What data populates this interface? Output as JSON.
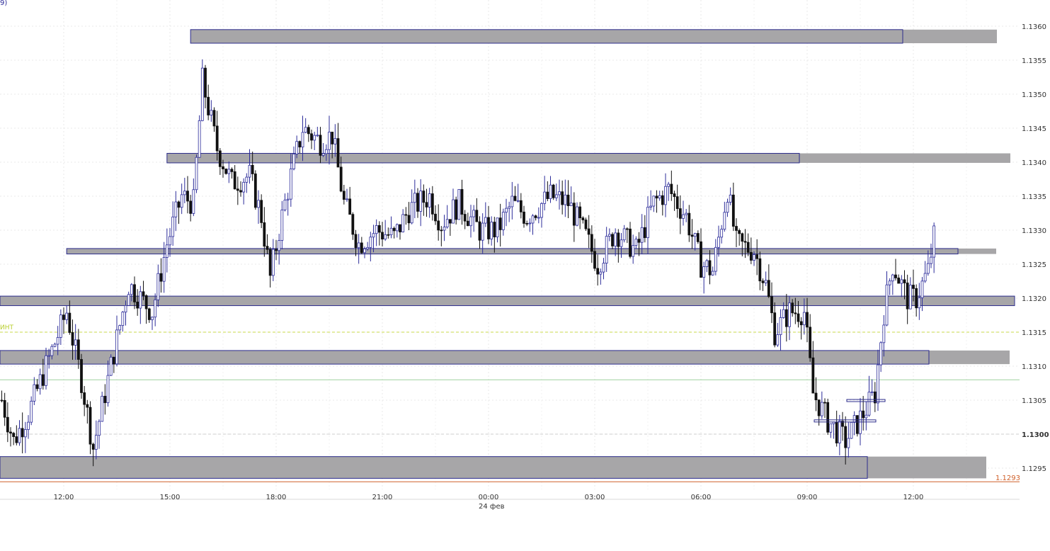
{
  "chart_data": {
    "type": "candlestick",
    "symbol_partial": "9)",
    "y_axis": {
      "ticks": [
        "1.1360",
        "1.1355",
        "1.1350",
        "1.1345",
        "1.1340",
        "1.1335",
        "1.1330",
        "1.1325",
        "1.1320",
        "1.1315",
        "1.1310",
        "1.1305",
        "1.1300",
        "1.1295"
      ],
      "ylim": [
        1.12925,
        1.13625
      ],
      "position": "right",
      "bold_tick": "1.1300"
    },
    "x_axis": {
      "ticks": [
        "12:00",
        "15:00",
        "18:00",
        "21:00",
        "00:00",
        "03:00",
        "06:00",
        "09:00",
        "12:00"
      ],
      "date_label": "24 фев",
      "date_under_tick": "00:00"
    },
    "grid": true,
    "last_price": {
      "label": "1.1293",
      "value": 1.1293,
      "color": "#d0602a"
    },
    "reference_lines": [
      {
        "value": 1.1315,
        "style": "dashed",
        "color": "#c8d84a",
        "label": "ИНТ"
      },
      {
        "value": 1.1308,
        "style": "solid",
        "color": "#9fd29f"
      },
      {
        "value": 1.13,
        "style": "dashed",
        "color": "#cccccc"
      }
    ],
    "zones": [
      {
        "top": 1.13595,
        "bottom": 1.13575,
        "start": "15:35",
        "end": "right"
      },
      {
        "top": 1.13413,
        "bottom": 1.13399,
        "start": "14:55",
        "end": "right"
      },
      {
        "top": 1.13273,
        "bottom": 1.13265,
        "start": "12:05",
        "end": "right"
      },
      {
        "top": 1.13203,
        "bottom": 1.13189,
        "start": "left",
        "end": "right"
      },
      {
        "top": 1.13123,
        "bottom": 1.13103,
        "start": "left",
        "end": "right"
      },
      {
        "top": 1.12967,
        "bottom": 1.12935,
        "start": "left",
        "end": "right"
      }
    ],
    "colors": {
      "zone_fill": "#a7a6a8",
      "zone_border": "#2c2c8c",
      "bull_body": "#ffffff",
      "bull_border": "#2c2c9a",
      "bear_body": "#111111",
      "grid": "#e8e8e8",
      "axis_text": "#333333"
    },
    "candle_interval_minutes": 5,
    "anchors": [
      [
        "10:15",
        1.1305
      ],
      [
        "10:35",
        1.1299
      ],
      [
        "11:00",
        1.1303
      ],
      [
        "11:30",
        1.131
      ],
      [
        "12:05",
        1.1318
      ],
      [
        "12:30",
        1.1308
      ],
      [
        "12:50",
        1.1298
      ],
      [
        "13:20",
        1.131
      ],
      [
        "13:50",
        1.1322
      ],
      [
        "14:30",
        1.1318
      ],
      [
        "14:55",
        1.1328
      ],
      [
        "15:20",
        1.1335
      ],
      [
        "15:40",
        1.1334
      ],
      [
        "15:55",
        1.1352
      ],
      [
        "16:20",
        1.1342
      ],
      [
        "16:45",
        1.1337
      ],
      [
        "17:15",
        1.1338
      ],
      [
        "17:35",
        1.1332
      ],
      [
        "17:50",
        1.1323
      ],
      [
        "18:05",
        1.133
      ],
      [
        "18:25",
        1.1338
      ],
      [
        "18:45",
        1.1345
      ],
      [
        "19:15",
        1.1343
      ],
      [
        "19:35",
        1.1344
      ],
      [
        "19:55",
        1.1334
      ],
      [
        "20:20",
        1.1328
      ],
      [
        "20:50",
        1.133
      ],
      [
        "21:20",
        1.1329
      ],
      [
        "21:45",
        1.1333
      ],
      [
        "22:20",
        1.1335
      ],
      [
        "22:40",
        1.1331
      ],
      [
        "23:10",
        1.1334
      ],
      [
        "23:45",
        1.133
      ],
      [
        "00:15",
        1.133
      ],
      [
        "00:40",
        1.1334
      ],
      [
        "01:05",
        1.1332
      ],
      [
        "01:45",
        1.1335
      ],
      [
        "02:15",
        1.1334
      ],
      [
        "02:45",
        1.1329
      ],
      [
        "03:05",
        1.1325
      ],
      [
        "03:35",
        1.133
      ],
      [
        "04:10",
        1.1327
      ],
      [
        "04:40",
        1.1334
      ],
      [
        "05:05",
        1.1336
      ],
      [
        "05:35",
        1.1332
      ],
      [
        "06:00",
        1.1325
      ],
      [
        "06:20",
        1.1324
      ],
      [
        "06:45",
        1.1336
      ],
      [
        "07:00",
        1.1328
      ],
      [
        "07:30",
        1.1327
      ],
      [
        "07:50",
        1.1322
      ],
      [
        "08:05",
        1.1315
      ],
      [
        "08:30",
        1.1318
      ],
      [
        "08:55",
        1.1318
      ],
      [
        "09:10",
        1.1306
      ],
      [
        "09:35",
        1.1302
      ],
      [
        "10:05",
        1.1299
      ],
      [
        "10:35",
        1.1303
      ],
      [
        "10:55",
        1.1306
      ],
      [
        "11:10",
        1.1318
      ],
      [
        "11:25",
        1.1325
      ],
      [
        "11:50",
        1.132
      ],
      [
        "12:05",
        1.132
      ],
      [
        "12:25",
        1.1324
      ],
      [
        "12:35",
        1.1329
      ]
    ]
  }
}
